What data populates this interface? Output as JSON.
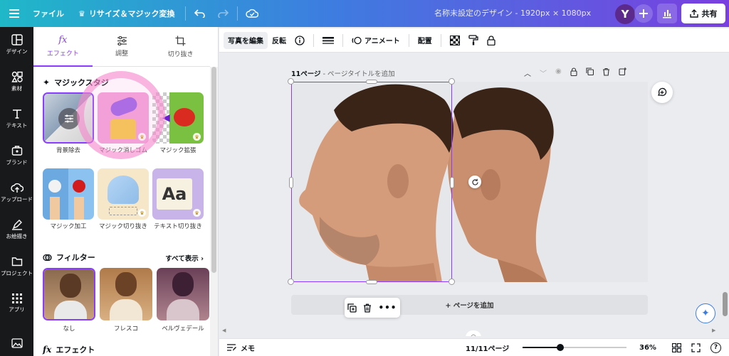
{
  "topbar": {
    "menu_icon": "hamburger-icon",
    "file_label": "ファイル",
    "resize_label": "リサイズ＆マジック変換",
    "doc_title": "名称未設定のデザイン - 1920px × 1080px",
    "avatar_letter": "Y",
    "share_label": "共有"
  },
  "rail": {
    "items": [
      {
        "label": "デザイン",
        "icon": "layout-icon"
      },
      {
        "label": "素材",
        "icon": "elements-icon"
      },
      {
        "label": "テキスト",
        "icon": "text-icon"
      },
      {
        "label": "ブランド",
        "icon": "brand-icon"
      },
      {
        "label": "アップロード",
        "icon": "upload-icon"
      },
      {
        "label": "お絵描き",
        "icon": "draw-icon"
      },
      {
        "label": "プロジェクト",
        "icon": "folder-icon"
      },
      {
        "label": "アプリ",
        "icon": "apps-icon"
      }
    ]
  },
  "panel": {
    "tabs": [
      {
        "label": "エフェクト",
        "icon": "fx-icon"
      },
      {
        "label": "調整",
        "icon": "sliders-icon"
      },
      {
        "label": "切り抜き",
        "icon": "crop-icon"
      }
    ],
    "magic_studio_title": "マジックスタジ",
    "magic_tools": [
      {
        "label": "背景除去"
      },
      {
        "label": "マジック消しゴム"
      },
      {
        "label": "マジック拡張"
      },
      {
        "label": "マジック加工"
      },
      {
        "label": "マジック切り抜き"
      },
      {
        "label": "テキスト切り抜き"
      }
    ],
    "filters_title": "フィルター",
    "see_all": "すべて表示",
    "filters": [
      {
        "label": "なし"
      },
      {
        "label": "フレスコ"
      },
      {
        "label": "ベルヴェデール"
      }
    ],
    "effects_title": "エフェクト"
  },
  "editbar": {
    "edit_photo": "写真を編集",
    "flip": "反転",
    "animate": "アニメート",
    "position": "配置"
  },
  "canvas": {
    "page_num": "11ページ",
    "page_title_placeholder": "- ページタイトルを追加",
    "add_page": "+ ページを追加"
  },
  "bottombar": {
    "notes": "メモ",
    "page_counter": "11/11ページ",
    "zoom": "36%",
    "zoom_fraction": 0.36
  }
}
